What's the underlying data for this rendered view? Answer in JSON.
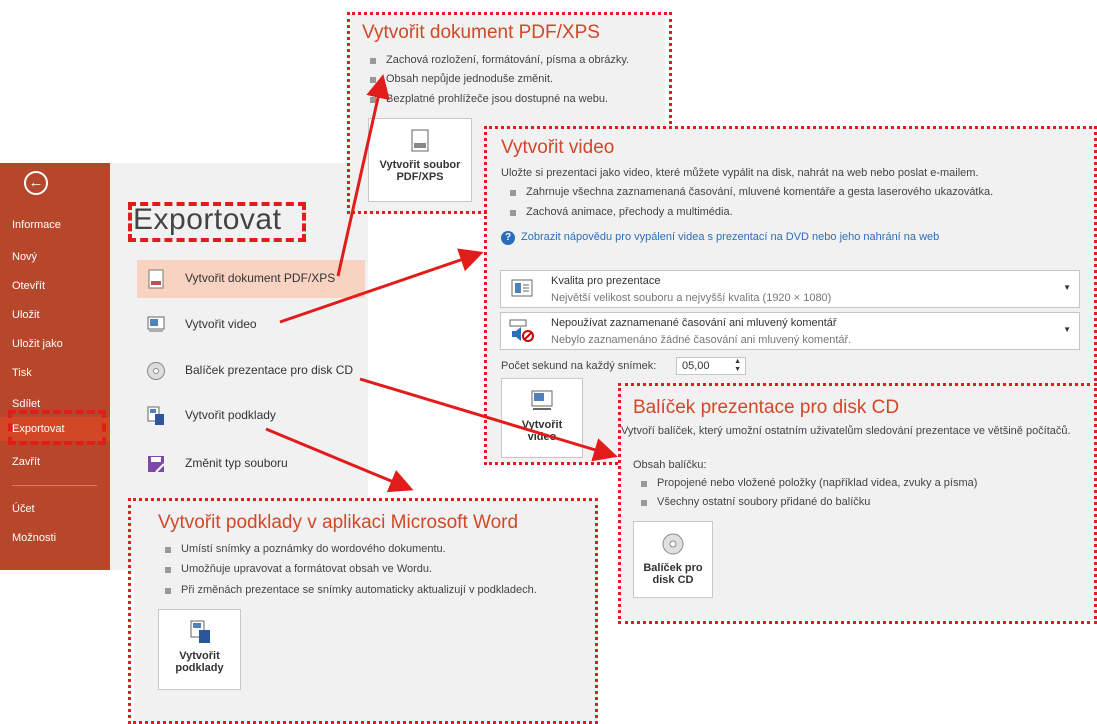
{
  "sidebar": {
    "back_icon": "back-arrow-circle-icon",
    "items": [
      {
        "label": "Informace"
      },
      {
        "label": "Nový"
      },
      {
        "label": "Otevřít"
      },
      {
        "label": "Uložit"
      },
      {
        "label": "Uložit jako"
      },
      {
        "label": "Tisk"
      },
      {
        "label": "Sdílet"
      },
      {
        "label": "Exportovat",
        "active": true
      },
      {
        "label": "Zavřít"
      },
      {
        "label": "Účet"
      },
      {
        "label": "Možnosti"
      }
    ]
  },
  "export": {
    "title": "Exportovat",
    "items": [
      {
        "label": "Vytvořit dokument PDF/XPS",
        "icon": "pdf-document-icon",
        "active": true
      },
      {
        "label": "Vytvořit video",
        "icon": "video-icon"
      },
      {
        "label": "Balíček prezentace pro disk CD",
        "icon": "cd-disc-icon"
      },
      {
        "label": "Vytvořit podklady",
        "icon": "handouts-icon"
      },
      {
        "label": "Změnit typ souboru",
        "icon": "save-file-type-icon"
      }
    ]
  },
  "pdf_panel": {
    "title": "Vytvořit dokument PDF/XPS",
    "bullets": [
      "Zachová rozložení, formátování, písma a obrázky.",
      "Obsah nepůjde jednoduše změnit.",
      "Bezplatné prohlížeče jsou dostupné na webu."
    ],
    "button_line1": "Vytvořit soubor",
    "button_line2": "PDF/XPS"
  },
  "video_panel": {
    "title": "Vytvořit video",
    "description": "Uložte si prezentaci jako video, které můžete vypálit na disk, nahrát na web nebo poslat e-mailem.",
    "bullets": [
      "Zahrnuje všechna zaznamenaná časování, mluvené komentáře a gesta laserového ukazovátka.",
      "Zachová animace, přechody a multimédia."
    ],
    "help_link": "Zobrazit nápovědu pro vypálení videa s prezentací na DVD nebo jeho nahrání na web",
    "quality": {
      "title": "Kvalita pro prezentace",
      "subtitle": "Největší velikost souboru a nejvyšší kvalita (1920 × 1080)"
    },
    "timing": {
      "title": "Nepoužívat zaznamenané časování ani mluvený komentář",
      "subtitle": "Nebylo zaznamenáno žádné časování ani mluvený komentář."
    },
    "seconds_label": "Počet sekund na každý snímek:",
    "seconds_value": "05,00",
    "button_line1": "Vytvořit",
    "button_line2": "video"
  },
  "cd_panel": {
    "title": "Balíček prezentace pro disk CD",
    "description": "Vytvoří balíček, který umožní ostatním uživatelům sledování prezentace ve většině počítačů.",
    "contents_label": "Obsah balíčku:",
    "bullets": [
      "Propojené nebo vložené položky (například videa, zvuky a písma)",
      "Všechny ostatní soubory přidané do balíčku"
    ],
    "button_line1": "Balíček pro",
    "button_line2": "disk CD"
  },
  "word_panel": {
    "title": "Vytvořit podklady v aplikaci Microsoft Word",
    "bullets": [
      "Umístí snímky a poznámky do wordového dokumentu.",
      "Umožňuje upravovat a formátovat obsah ve Wordu.",
      "Při změnách prezentace se snímky automaticky aktualizují v podkladech."
    ],
    "button_line1": "Vytvořit",
    "button_line2": "podklady"
  },
  "colors": {
    "accent": "#d24726",
    "sidebar": "#b7472a",
    "annotation": "#e21b1b",
    "link": "#2a6ebb"
  }
}
